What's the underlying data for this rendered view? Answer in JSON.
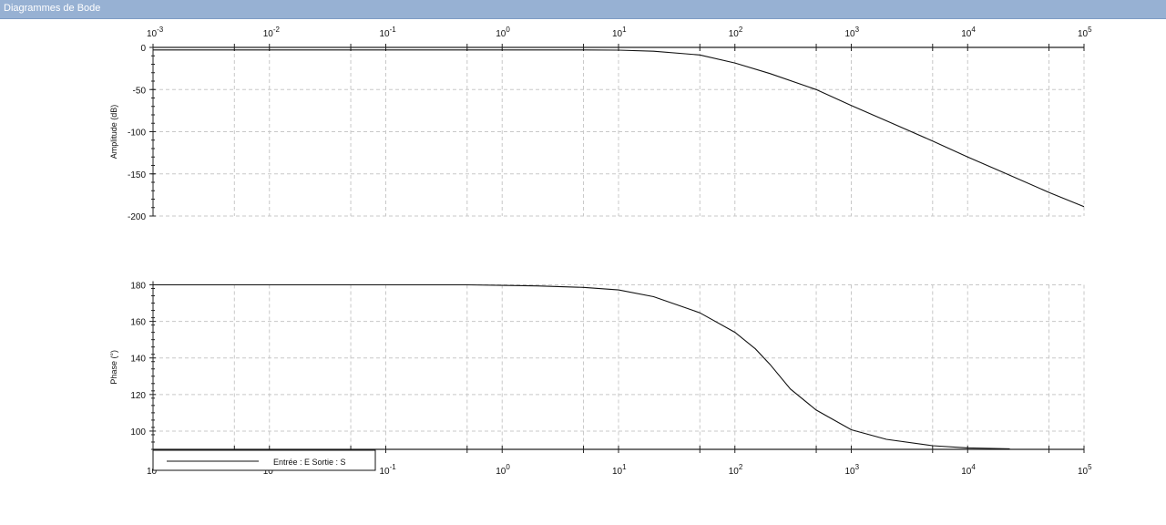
{
  "window": {
    "title": "Diagrammes de Bode"
  },
  "chart_data": [
    {
      "type": "line",
      "xscale": "log",
      "xlim": [
        0.001,
        100000
      ],
      "x_tick_labels": [
        [
          "10",
          "-3"
        ],
        [
          "10",
          "-2"
        ],
        [
          "10",
          "-1"
        ],
        [
          "10",
          "0"
        ],
        [
          "10",
          "1"
        ],
        [
          "10",
          "2"
        ],
        [
          "10",
          "3"
        ],
        [
          "10",
          "4"
        ],
        [
          "10",
          "5"
        ]
      ],
      "ylabel": "Amplitude (dB)",
      "ylim": [
        -200,
        0
      ],
      "y_ticks": [
        0,
        -50,
        -100,
        -150,
        -200
      ],
      "grid": true,
      "series": [
        {
          "x": [
            0.001,
            1,
            5,
            10,
            20,
            50,
            100,
            200,
            500,
            1000,
            2000,
            5000,
            10000,
            20000,
            50000,
            100000
          ],
          "y": [
            -3,
            -3,
            -3,
            -3.2,
            -4.5,
            -9,
            -18.5,
            -31,
            -50,
            -69,
            -87,
            -111,
            -130,
            -148,
            -172,
            -189
          ]
        }
      ]
    },
    {
      "type": "line",
      "xscale": "log",
      "xlim": [
        0.001,
        100000
      ],
      "x_tick_labels": [
        [
          "10",
          ""
        ],
        [
          "10",
          ""
        ],
        [
          "10",
          "-1"
        ],
        [
          "10",
          "0"
        ],
        [
          "10",
          "1"
        ],
        [
          "10",
          "2"
        ],
        [
          "10",
          "3"
        ],
        [
          "10",
          "4"
        ],
        [
          "10",
          "5"
        ]
      ],
      "ylabel": "Phase (°)",
      "ylim": [
        90,
        180
      ],
      "y_ticks": [
        100,
        120,
        140,
        160,
        180
      ],
      "grid": true,
      "legend": {
        "label": "Entrée : E Sortie : S",
        "position": "bottom-left"
      },
      "series": [
        {
          "name": "Entrée : E Sortie : S",
          "x": [
            0.001,
            0.5,
            1,
            2,
            5,
            10,
            20,
            50,
            100,
            150,
            200,
            300,
            500,
            1000,
            2000,
            5000,
            10000,
            23000
          ],
          "y": [
            180,
            180,
            179.7,
            179.4,
            178.6,
            177.2,
            173.5,
            164.7,
            154,
            145,
            136.5,
            123,
            111.5,
            100.7,
            95.5,
            92,
            90.8,
            90.3
          ]
        }
      ]
    }
  ]
}
